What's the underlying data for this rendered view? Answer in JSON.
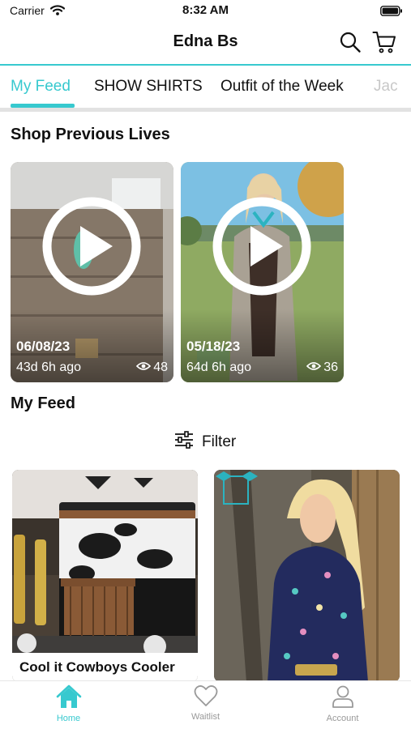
{
  "status_bar": {
    "carrier": "Carrier",
    "time": "8:32 AM"
  },
  "header": {
    "title": "Edna Bs",
    "icons": [
      "search-icon",
      "cart-icon"
    ]
  },
  "tabs": [
    {
      "label": "My Feed",
      "active": true
    },
    {
      "label": "SHOW SHIRTS"
    },
    {
      "label": "Outfit of the Week"
    },
    {
      "label": "Jac"
    }
  ],
  "previous_lives": {
    "heading": "Shop Previous Lives",
    "items": [
      {
        "date": "06/08/23",
        "ago": "43d 6h ago",
        "views": "48"
      },
      {
        "date": "05/18/23",
        "ago": "64d 6h ago",
        "views": "36"
      }
    ]
  },
  "feed": {
    "heading": "My Feed",
    "filter_label": "Filter",
    "products": [
      {
        "name": "Cool it Cowboys Cooler"
      },
      {
        "name": ""
      }
    ]
  },
  "bottom_tabs": [
    {
      "label": "Home",
      "icon": "home-icon",
      "active": true
    },
    {
      "label": "Waitlist",
      "icon": "heart-icon"
    },
    {
      "label": "Account",
      "icon": "person-icon"
    }
  ],
  "colors": {
    "accent": "#37c9cf",
    "text": "#111111",
    "inactive": "#999999"
  }
}
